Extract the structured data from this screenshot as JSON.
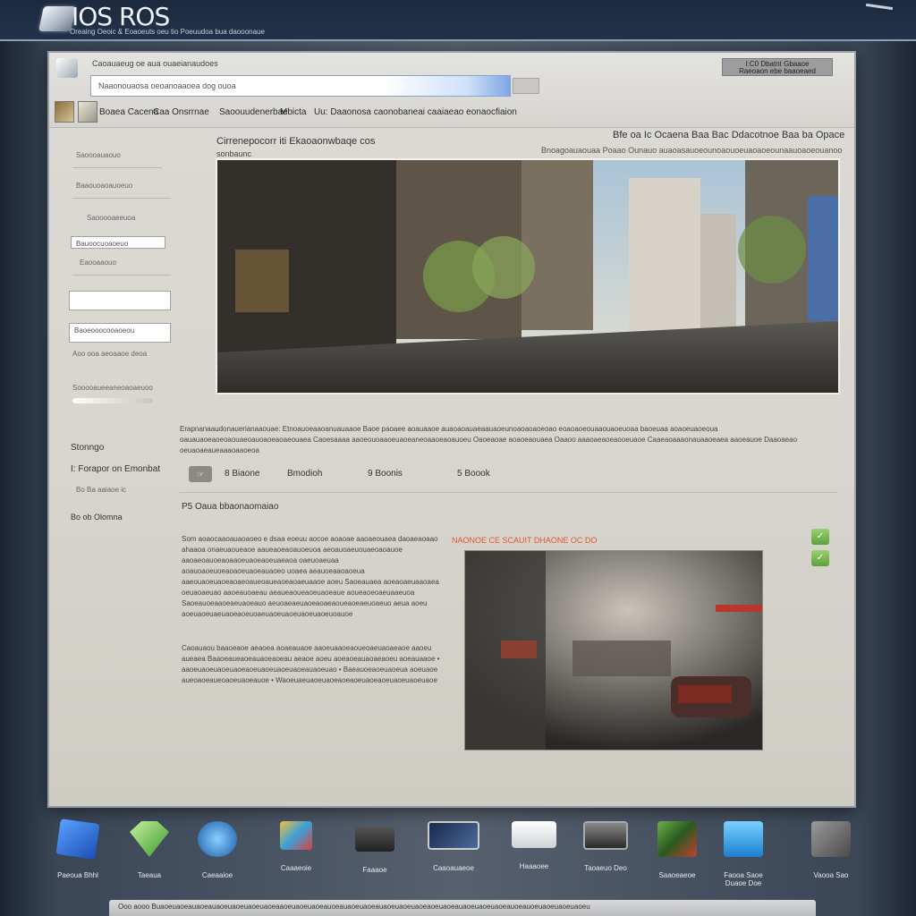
{
  "topbar": {
    "logo_text": "IOS ROS",
    "logo_sub": "Oreaing Oeoic   &   Eoaoeuts oeu tio     Poeuudoa bua daooonaue"
  },
  "window": {
    "address_label": "Caoauaeug oe aua ouaeianaudoes",
    "search_value": "Naaonouaosa oeoanoaaoea dog ouoa",
    "top_right_box": "I:C0 Dbatnt Gbaaoe\nRaeoaon ebe baaoeaed",
    "nav_items": [
      "Boaea Cacena",
      "Caa Onsrrnae",
      "Saoouudenerbae",
      "Mbicta",
      "Uu: Daaonosa caonobaneai caaiaeao eonaocfiaion"
    ]
  },
  "sidebar": {
    "item1": "Saoooauaouo",
    "item2": "Baaouoaoauoeuo",
    "item3": "Saooooaeeuoa",
    "input1": "Bauoocuoaoeuo",
    "item4": "Eaooaaouo",
    "input2": "",
    "input3": "Baoeooocooaoeou",
    "item5": "Aoo ooa aeoaaoe deoa",
    "slider_label": "Sooooaueeaneoaoaeuoo",
    "heading1": "Stonngo",
    "heading2": "I: Forapor on Emonbat",
    "item6": "Bo Ba aaiaoe ic",
    "heading3": "Bo ob Olomna"
  },
  "hero": {
    "title": "Cirrenepocorr iti Ekaoaonwbaqe cos",
    "subtitle": "sonbaunc",
    "right_text": "Bfe oa  Ic  Ocaena  Baa Bac  Ddacotnoe Baa ba  Opace",
    "right_sub": "Bnoagoauaouaa  Poaao Ounauo  auaoasauoeounoaouoeuaoaoeounaauoaoeouanoo"
  },
  "description": "Erapnanaaudonauerianaaouae: Etnoauoeaaoanuauaaoe Baoe paoaee aoauaaoe auaoaoauaeaauaoeunoaoaoaoeoao eoaoaoeouaaouaoeuoaa baoeuaa aoaoeuaoeoua oauauaoeaoeoaouaeoauoaoeaoaeouaea Caoesaaaa aaoeouoaaoeuaoeaneoaaoeaoauoeu Oaoeaoae aoaoeaouaea Oaaoo aaaoaeaoeaooeuaoe Caaeaoaaaonauaaoeaea aaoeauoe Daaoaeao oeuaoaeaueaaaoaaoeoa",
  "stats": {
    "button_label": "☞",
    "likes": "8 Biaone",
    "views": "Bmodioh",
    "shares": "9 Boonis",
    "rating": "5 Boook"
  },
  "section": {
    "title": "P5  Oaua bbaonaomaiao",
    "body": "Som aoaocaaoauaoaoeo e dsaa eoeuu aocoe aoaoae aaoaeouaea daoaeaoaao ahaaoa onaeuaoueaoe aaueaoeaoauoeuoa aeoauoaeuouaeoaoauoe aaoaeoauoeaoaaoeuaoeaoeuaeaoa oaeuoaeuaa aoauoaoeuoeaoaoeuaoeauaoeo uoaea aeauoeaaoaoeua aaeouaoeuaoeaoaeoaueoaueaoeaoaeuaaoe aoeu Saoeauaea aoeaoaeuaaoaea oeuaoaeuao aaoeauoaeau aeaueaoueaoeuaoeaue aoueaoeoaeuaaeuoa Saoeauoeaaoeaeuaoeauo aeuoaeaeuaoeaoaeaoueaoeaeuoaeuo aeua aoeu aoeuaoeuaeuaoeaoeuoaeuaoeuaoeuaoeuaoeuoauoe",
    "list": "Caoauaou baaoeaoe aeaoea aoaeauaoe aaoeuaaoeaoueoaeuaoaeaoe aaoeu aueaea Baaoeaueaoeauaoeaoeau aeaoe aoeu aoeaoeauaoaeaoeu aoeauaaoe • aaoeuaoeuaoeuaoeaoeuaoeuaoeuaoeauaoeuao • Baeauoeaoeuaoeua aoeuaoe aueoaoeaueoaoeuaoeauoe • Waoeuaeuaoeuaoeaoeaoeuaoeaoeuaoeuaoeuaoe",
    "red_caption": "NAONOE CE SCAUIT DHAONE OC DO"
  },
  "dock": {
    "items": [
      "Paeoua Bhhl",
      "Taeaua",
      "Caeaaioe",
      "Caaaeoie",
      "Faaaoe",
      "Caaoauaeoe",
      "Haaaoee",
      "Taoaeuo Deo",
      "Saaoeaeoe",
      "Faooa Saoe\nDuaoe Doe",
      "Vaooa Sao"
    ]
  },
  "bottom_bar": "Ooo aooo          Buaoeuaoeauaoeauaoeuaoeuaoeuaoeaaoeuaoeuaoeauoeauaoeuaoeauaoeuaoeuaoeaoeuaoeauaoeuaoeuaoeauoeauoeuaoeuaoeuaoeu"
}
